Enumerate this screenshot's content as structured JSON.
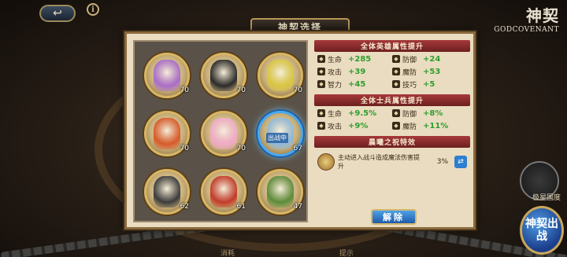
{
  "top": {
    "back_icon": "back-arrow-icon",
    "info_icon": "info-icon",
    "info_glyph": "i",
    "back_glyph": "↩",
    "logo_zh": "神契",
    "logo_en": "GODCOVENANT"
  },
  "panel": {
    "title": "神契选择"
  },
  "slots": [
    {
      "level": "70",
      "art_color": "#a96cc8",
      "selected": false
    },
    {
      "level": "70",
      "art_color": "#2b2b2b",
      "selected": false
    },
    {
      "level": "70",
      "art_color": "#d9c640",
      "selected": false
    },
    {
      "level": "70",
      "art_color": "#d85a2a",
      "selected": false
    },
    {
      "level": "70",
      "art_color": "#f0a9c6",
      "selected": false
    },
    {
      "level": "67",
      "art_color": "#8fb8d8",
      "selected": true,
      "tag": "出战中"
    },
    {
      "level": "62",
      "art_color": "#3c3c3c",
      "selected": false
    },
    {
      "level": "61",
      "art_color": "#c23a2a",
      "selected": false
    },
    {
      "level": "47",
      "art_color": "#5d8b3a",
      "selected": false
    }
  ],
  "hero_section": {
    "title": "全体英雄属性提升",
    "stats": [
      {
        "name": "生命",
        "value": "+285",
        "icon": "heart-icon"
      },
      {
        "name": "防御",
        "value": "+24",
        "icon": "shield-icon"
      },
      {
        "name": "攻击",
        "value": "+39",
        "icon": "sword-icon"
      },
      {
        "name": "魔防",
        "value": "+53",
        "icon": "magic-shield-icon"
      },
      {
        "name": "智力",
        "value": "+45",
        "icon": "book-icon"
      },
      {
        "name": "技巧",
        "value": "+5",
        "icon": "skill-icon"
      }
    ]
  },
  "soldier_section": {
    "title": "全体士兵属性提升",
    "stats": [
      {
        "name": "生命",
        "value": "+9.5%",
        "icon": "heart-icon"
      },
      {
        "name": "防御",
        "value": "+8%",
        "icon": "shield-icon"
      },
      {
        "name": "攻击",
        "value": "+9%",
        "icon": "sword-icon"
      },
      {
        "name": "魔防",
        "value": "+11%",
        "icon": "magic-shield-icon"
      }
    ]
  },
  "blessing_section": {
    "title": "晨曦之祝特效",
    "text": "主动进入战斗造成魔法伤害提升",
    "value": "3%",
    "swap_glyph": "⇄"
  },
  "release_button": "解除",
  "right_side": {
    "emblem_label": "极星国度",
    "action_label": "神契出战"
  },
  "bottom": {
    "left_label": "消耗",
    "right_label": "提示"
  },
  "colors": {
    "accent_blue": "#2e7fcf",
    "stat_green": "#2f9e2f",
    "header_red": "#a6393a"
  }
}
